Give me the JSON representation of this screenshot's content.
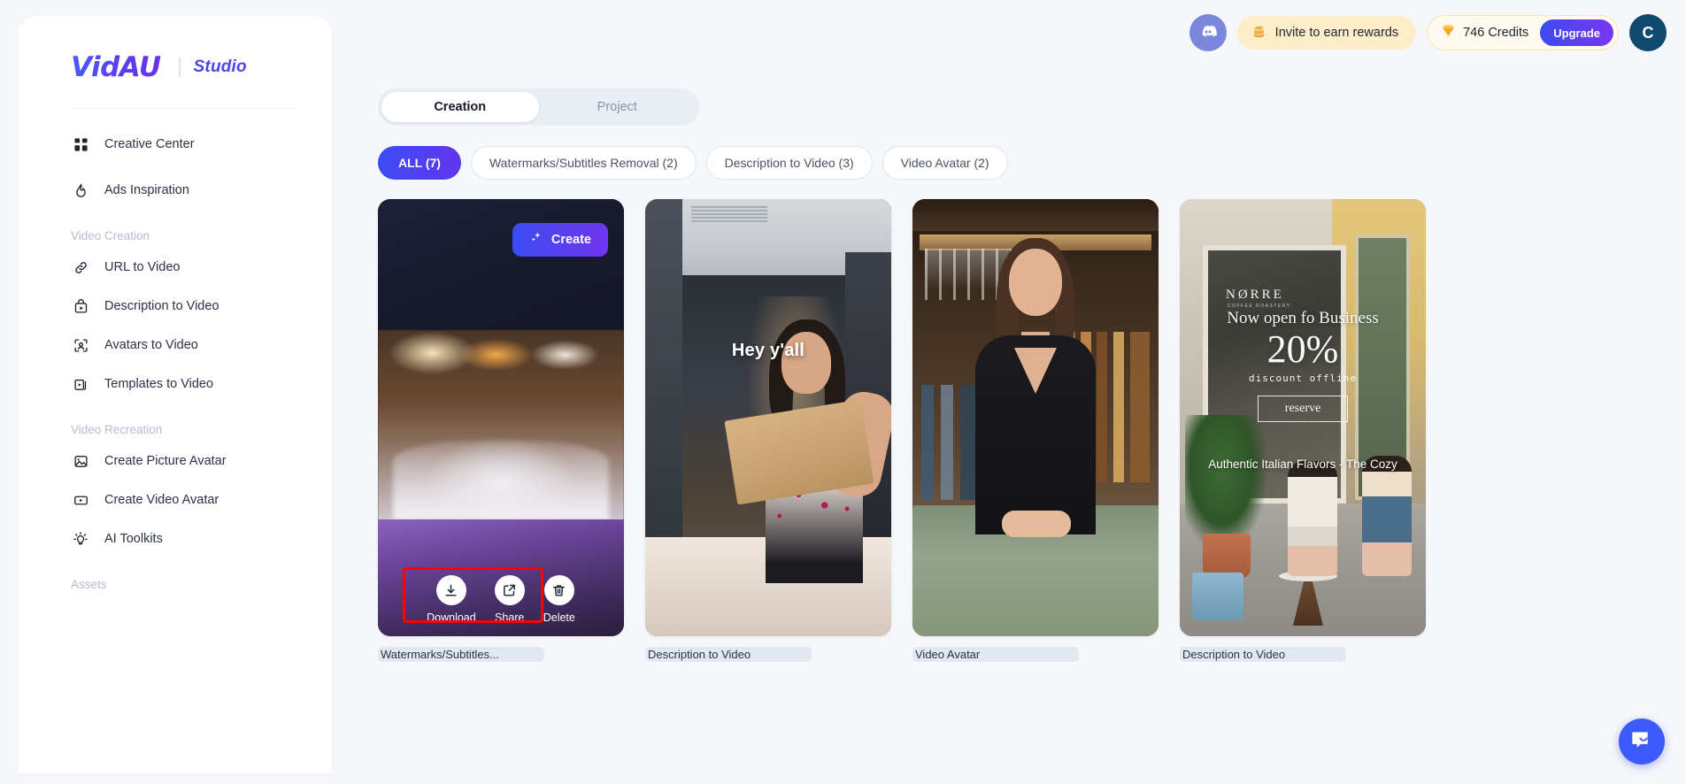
{
  "brand": {
    "logo": "VidAU",
    "suffix": "Studio"
  },
  "sidebar": {
    "top_items": [
      {
        "label": "Creative Center",
        "icon": "grid-icon"
      },
      {
        "label": "Ads Inspiration",
        "icon": "flame-icon"
      }
    ],
    "sections": [
      {
        "title": "Video Creation",
        "items": [
          {
            "label": "URL to Video",
            "icon": "link-icon"
          },
          {
            "label": "Description to Video",
            "icon": "video-bag-icon"
          },
          {
            "label": "Avatars to Video",
            "icon": "avatar-frame-icon"
          },
          {
            "label": "Templates to Video",
            "icon": "templates-icon"
          }
        ]
      },
      {
        "title": "Video Recreation",
        "items": [
          {
            "label": "Create Picture Avatar",
            "icon": "image-icon"
          },
          {
            "label": "Create Video Avatar",
            "icon": "video-play-icon"
          },
          {
            "label": "AI Toolkits",
            "icon": "lightbulb-icon"
          }
        ]
      },
      {
        "title": "Assets",
        "items": []
      }
    ]
  },
  "header": {
    "discord_label": "discord-icon",
    "invite_label": "Invite to earn rewards",
    "invite_icon": "coins-icon",
    "credits_value": "746 Credits",
    "credits_icon": "diamond-icon",
    "upgrade_label": "Upgrade",
    "avatar_initial": "C"
  },
  "main": {
    "tabs": [
      {
        "label": "Creation",
        "active": true
      },
      {
        "label": "Project",
        "active": false
      }
    ],
    "filters": [
      {
        "label": "ALL (7)",
        "active": true
      },
      {
        "label": "Watermarks/Subtitles Removal (2)",
        "active": false
      },
      {
        "label": "Description to Video (3)",
        "active": false
      },
      {
        "label": "Video Avatar (2)",
        "active": false
      }
    ],
    "cards": [
      {
        "title": "Watermarks/Subtitles...",
        "create_label": "Create",
        "actions": [
          {
            "label": "Download",
            "icon": "download-icon"
          },
          {
            "label": "Share",
            "icon": "share-icon"
          },
          {
            "label": "Delete",
            "icon": "trash-icon"
          }
        ]
      },
      {
        "title": "Description to Video",
        "caption": "Hey y'all"
      },
      {
        "title": "Video Avatar"
      },
      {
        "title": "Description to Video",
        "overlay": {
          "shop": "NØRRE",
          "shop_sub": "COFFEE ROASTERY",
          "headline": "Now open fo Business",
          "percent": "20%",
          "discount": "discount offline",
          "cta": "reserve",
          "caption": "Authentic Italian Flavors - The Cozy"
        }
      }
    ]
  },
  "intercom": {
    "icon": "chat-bubble-icon"
  },
  "colors": {
    "brand": "#4c45e8",
    "accent_gradient_start": "#3b4cf3",
    "accent_gradient_end": "#7135f0",
    "highlight_box": "#ff0000",
    "credits_bg": "#fefaf0",
    "invite_bg": "#fdeec9"
  }
}
